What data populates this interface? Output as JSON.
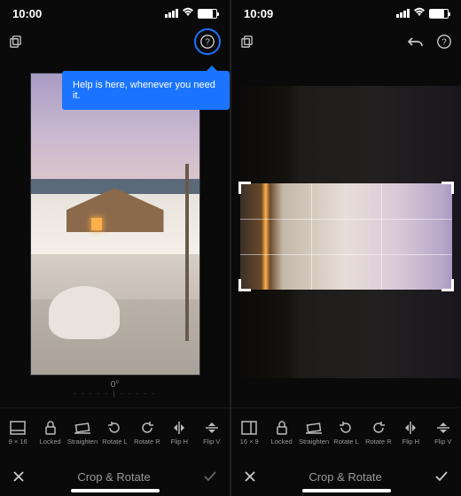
{
  "left": {
    "time": "10:00",
    "tooltip": "Help is here, whenever you need it.",
    "angle": "0°",
    "tools": [
      {
        "label": "9 × 16",
        "icon": "aspect"
      },
      {
        "label": "Locked",
        "icon": "lock"
      },
      {
        "label": "Straighten",
        "icon": "straighten"
      },
      {
        "label": "Rotate L",
        "icon": "rotl"
      },
      {
        "label": "Rotate R",
        "icon": "rotr"
      },
      {
        "label": "Flip H",
        "icon": "fliph"
      },
      {
        "label": "Flip V",
        "icon": "flipv"
      }
    ],
    "title": "Crop & Rotate"
  },
  "right": {
    "time": "10:09",
    "tools": [
      {
        "label": "16 × 9",
        "icon": "aspect"
      },
      {
        "label": "Locked",
        "icon": "lock"
      },
      {
        "label": "Straighten",
        "icon": "straighten"
      },
      {
        "label": "Rotate L",
        "icon": "rotl"
      },
      {
        "label": "Rotate R",
        "icon": "rotr"
      },
      {
        "label": "Flip H",
        "icon": "fliph"
      },
      {
        "label": "Flip V",
        "icon": "flipv"
      }
    ],
    "title": "Crop & Rotate"
  }
}
